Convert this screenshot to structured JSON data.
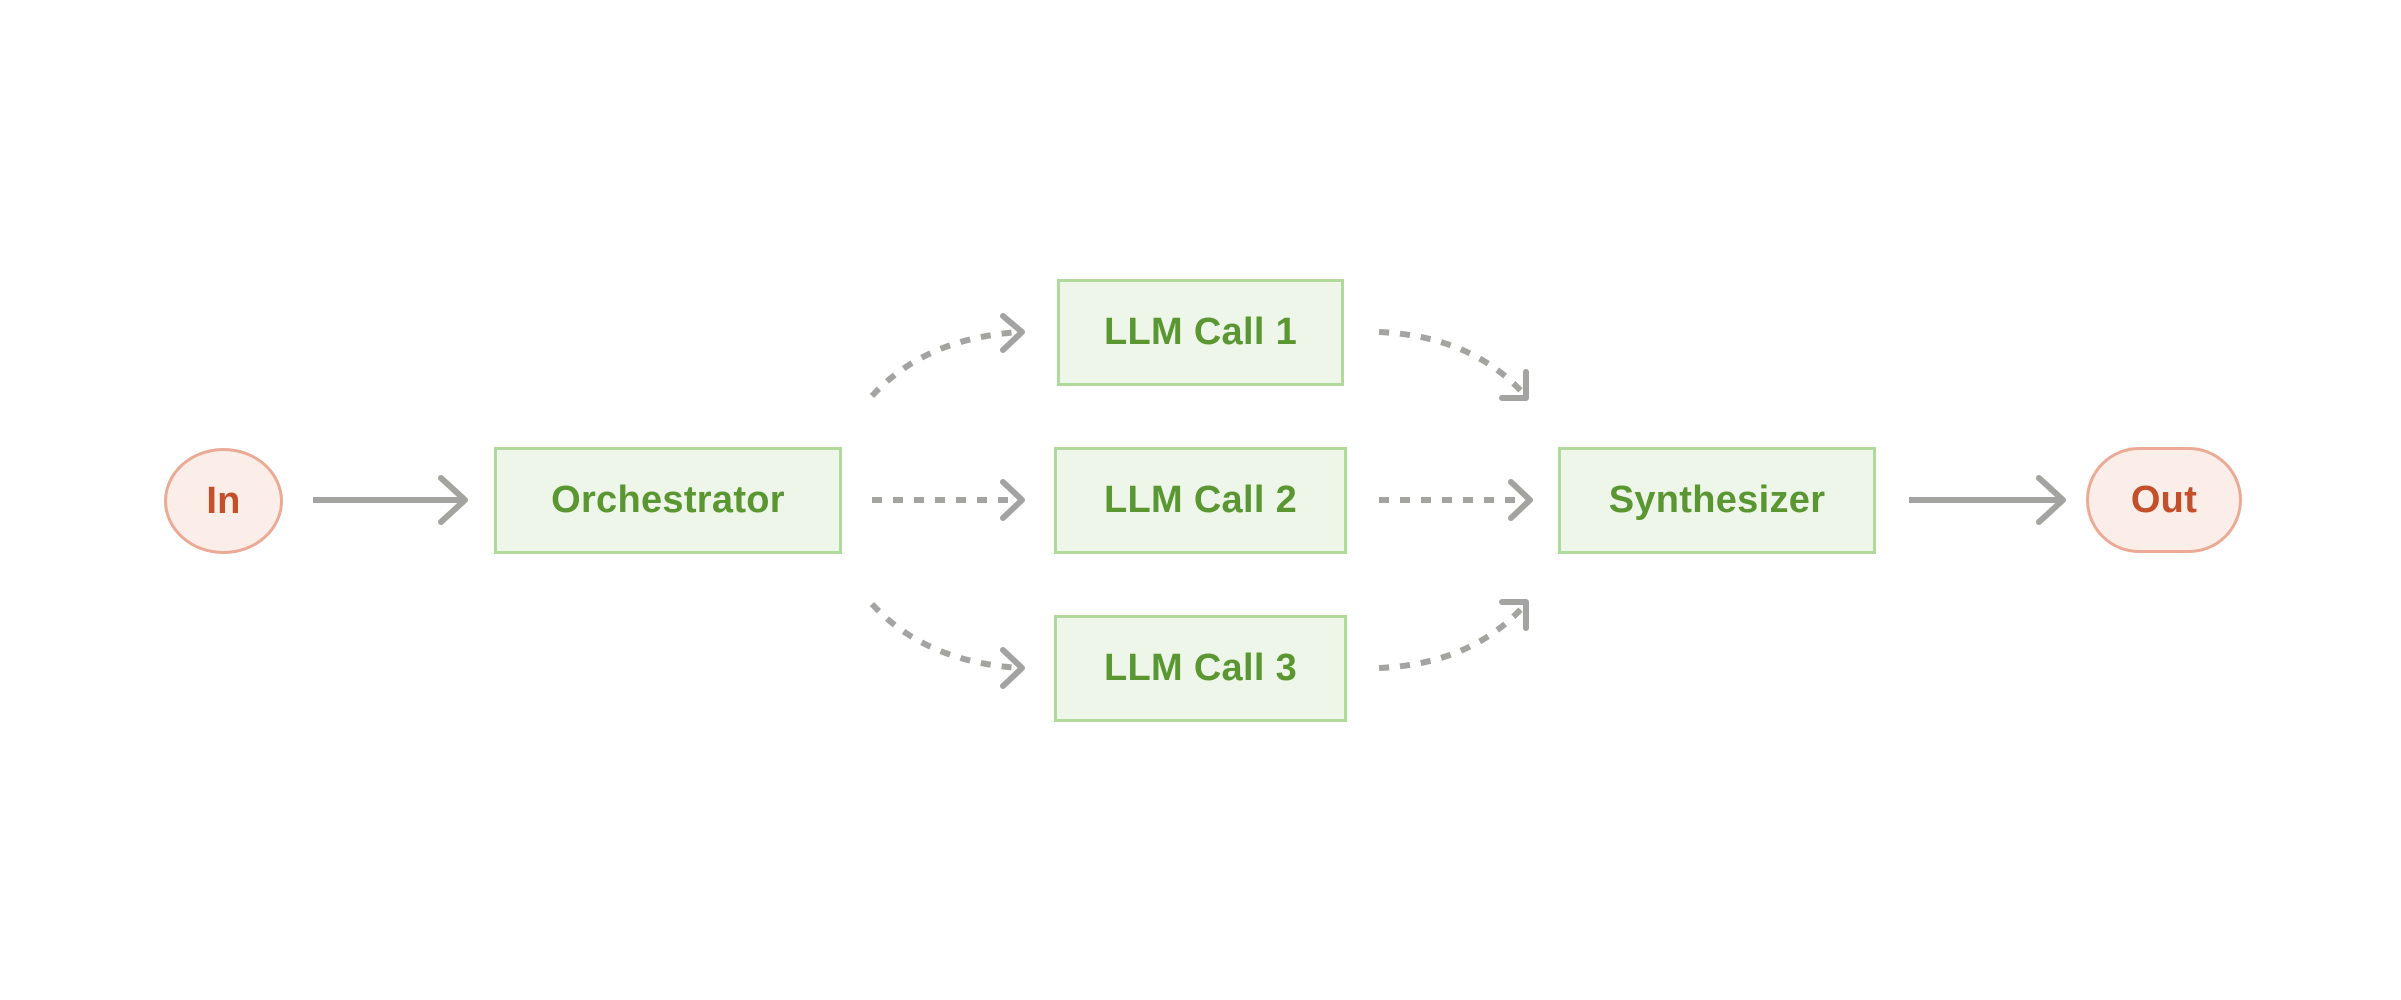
{
  "diagram": {
    "type": "flowchart",
    "pattern": "orchestrator-workers",
    "colors": {
      "process_fill": "#EEF5E9",
      "process_border": "#AFDA9B",
      "process_text": "#5A9631",
      "terminal_fill": "#FBEDE8",
      "terminal_border": "#EBAA95",
      "terminal_text": "#C4502B",
      "edge": "#A3A39F",
      "background": "#FFFFFF"
    },
    "nodes": {
      "in": {
        "label": "In",
        "kind": "terminal"
      },
      "orchestrator": {
        "label": "Orchestrator",
        "kind": "process"
      },
      "llm_call_1": {
        "label": "LLM Call 1",
        "kind": "process"
      },
      "llm_call_2": {
        "label": "LLM Call 2",
        "kind": "process"
      },
      "llm_call_3": {
        "label": "LLM Call 3",
        "kind": "process"
      },
      "synthesizer": {
        "label": "Synthesizer",
        "kind": "process"
      },
      "out": {
        "label": "Out",
        "kind": "terminal"
      }
    },
    "edges": [
      {
        "from": "in",
        "to": "orchestrator",
        "style": "solid"
      },
      {
        "from": "orchestrator",
        "to": "llm_call_1",
        "style": "dashed"
      },
      {
        "from": "orchestrator",
        "to": "llm_call_2",
        "style": "dashed"
      },
      {
        "from": "orchestrator",
        "to": "llm_call_3",
        "style": "dashed"
      },
      {
        "from": "llm_call_1",
        "to": "synthesizer",
        "style": "dashed"
      },
      {
        "from": "llm_call_2",
        "to": "synthesizer",
        "style": "dashed"
      },
      {
        "from": "llm_call_3",
        "to": "synthesizer",
        "style": "dashed"
      },
      {
        "from": "synthesizer",
        "to": "out",
        "style": "solid"
      }
    ]
  }
}
